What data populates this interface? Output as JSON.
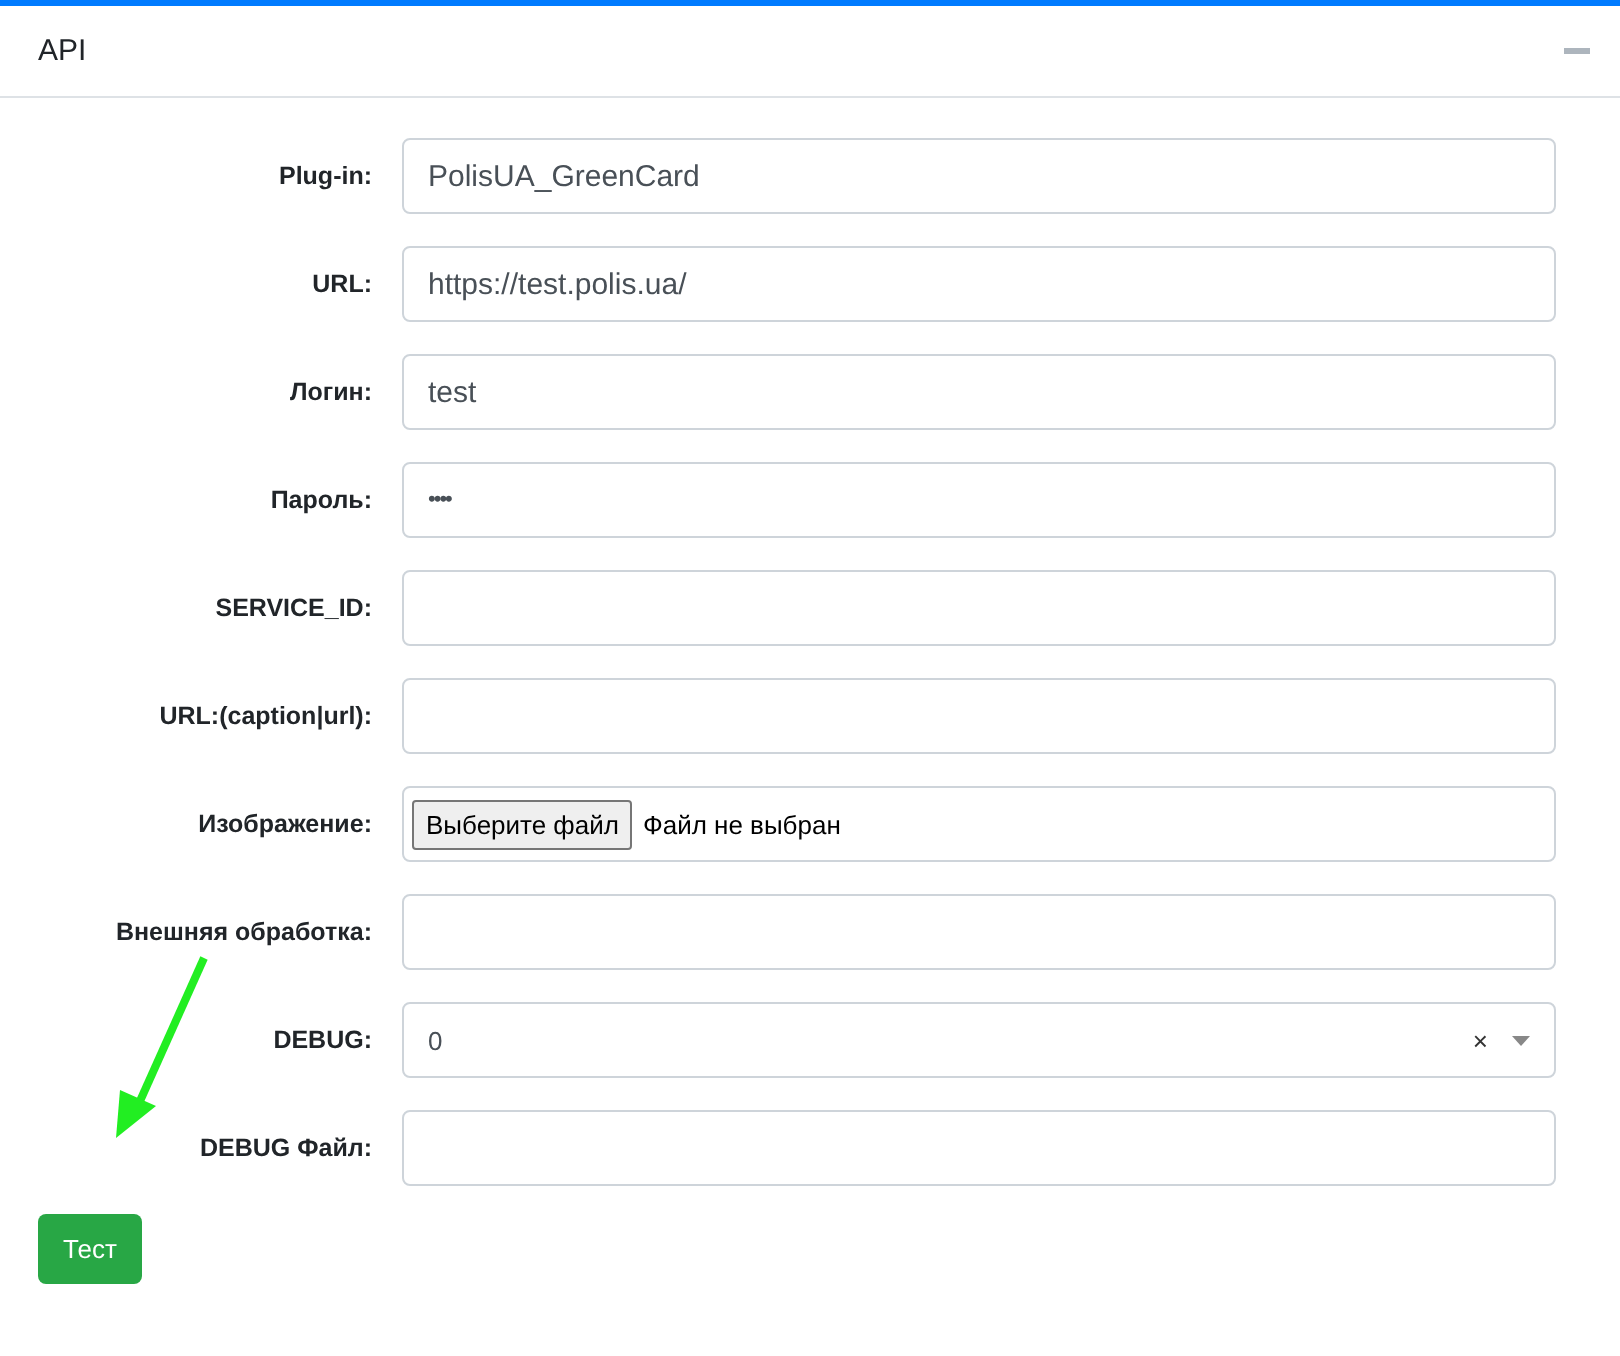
{
  "card": {
    "title": "API"
  },
  "fields": [
    {
      "kind": "text",
      "label": "Plug-in:",
      "value": "PolisUA_GreenCard"
    },
    {
      "kind": "text",
      "label": "URL:",
      "value": "https://test.polis.ua/"
    },
    {
      "kind": "text",
      "label": "Логин:",
      "value": "test"
    },
    {
      "kind": "password",
      "label": "Пароль:",
      "value": "••••"
    },
    {
      "kind": "text",
      "label": "SERVICE_ID:"
    },
    {
      "kind": "text",
      "label": "URL:(caption|url):"
    },
    {
      "kind": "file",
      "label": "Изображение:",
      "button": "Выберите файл",
      "status": "Файл не выбран"
    },
    {
      "kind": "text",
      "label": "Внешняя обработка:"
    },
    {
      "kind": "select",
      "label": "DEBUG:",
      "value": "0",
      "clear": "×"
    },
    {
      "kind": "text",
      "label": "DEBUG Файл:"
    }
  ],
  "button": "Тест"
}
